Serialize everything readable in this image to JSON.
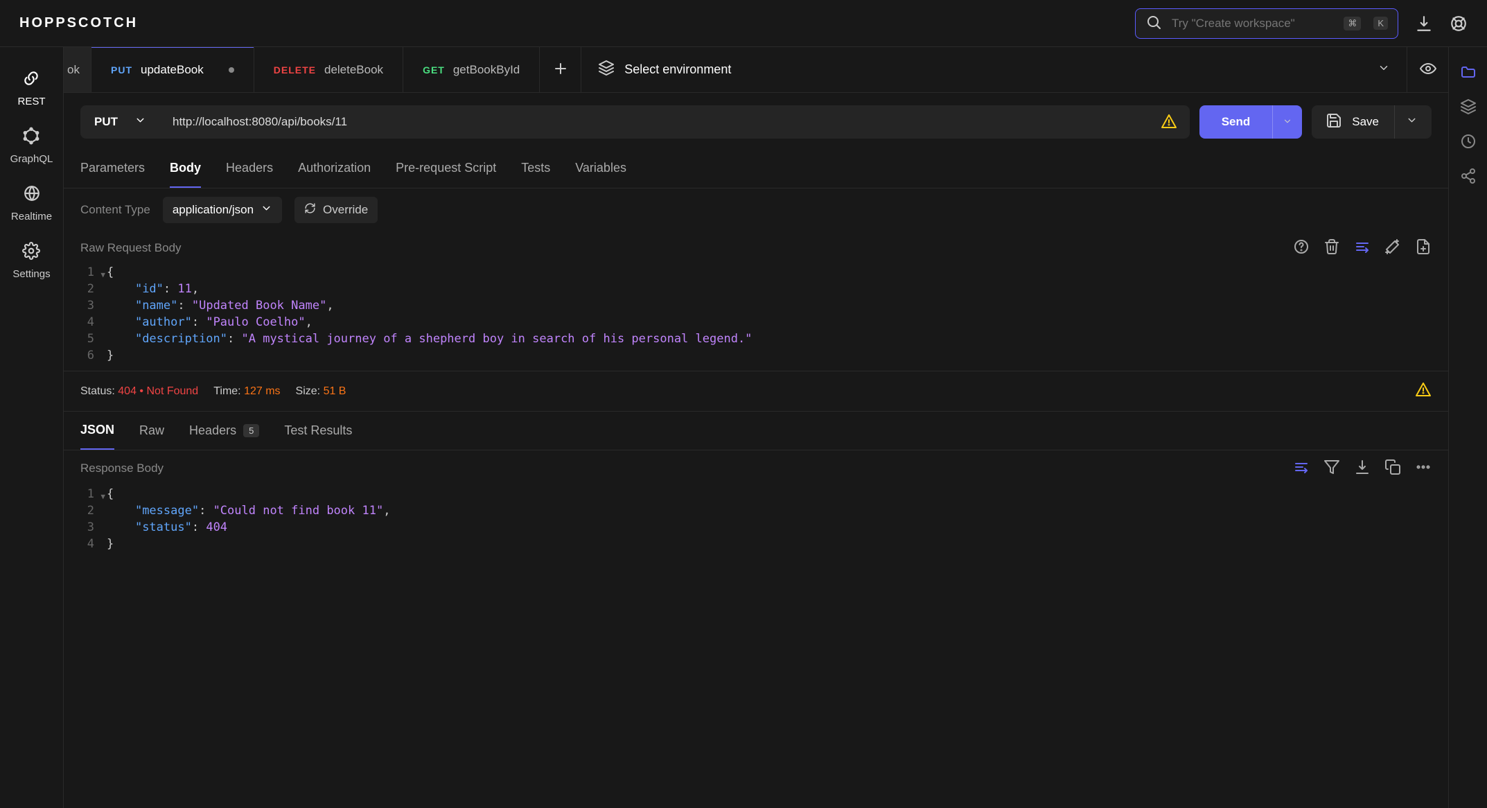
{
  "app": {
    "name": "HOPPSCOTCH"
  },
  "search": {
    "placeholder": "Try \"Create workspace\"",
    "shortcut_mod": "⌘",
    "shortcut_key": "K"
  },
  "leftnav": {
    "items": [
      {
        "label": "REST"
      },
      {
        "label": "GraphQL"
      },
      {
        "label": "Realtime"
      },
      {
        "label": "Settings"
      }
    ]
  },
  "tabs": {
    "partial": "ok",
    "items": [
      {
        "method": "PUT",
        "name": "updateBook",
        "dirty": true,
        "active": true
      },
      {
        "method": "DELETE",
        "name": "deleteBook"
      },
      {
        "method": "GET",
        "name": "getBookById"
      }
    ]
  },
  "environment": {
    "label": "Select environment"
  },
  "request": {
    "method": "PUT",
    "url": "http://localhost:8080/api/books/11",
    "send_label": "Send",
    "save_label": "Save"
  },
  "subtabs": [
    "Parameters",
    "Body",
    "Headers",
    "Authorization",
    "Pre-request Script",
    "Tests",
    "Variables"
  ],
  "subtab_active": "Body",
  "content_type": {
    "label": "Content Type",
    "value": "application/json",
    "override": "Override"
  },
  "body_section_label": "Raw Request Body",
  "request_body": {
    "lines": [
      {
        "n": 1,
        "fold": true,
        "segs": [
          {
            "t": "punc",
            "v": "{"
          }
        ]
      },
      {
        "n": 2,
        "segs": [
          {
            "t": "indent",
            "v": "    "
          },
          {
            "t": "key",
            "v": "\"id\""
          },
          {
            "t": "punc",
            "v": ": "
          },
          {
            "t": "num",
            "v": "11"
          },
          {
            "t": "punc",
            "v": ","
          }
        ]
      },
      {
        "n": 3,
        "segs": [
          {
            "t": "indent",
            "v": "    "
          },
          {
            "t": "key",
            "v": "\"name\""
          },
          {
            "t": "punc",
            "v": ": "
          },
          {
            "t": "str",
            "v": "\"Updated Book Name\""
          },
          {
            "t": "punc",
            "v": ","
          }
        ]
      },
      {
        "n": 4,
        "segs": [
          {
            "t": "indent",
            "v": "    "
          },
          {
            "t": "key",
            "v": "\"author\""
          },
          {
            "t": "punc",
            "v": ": "
          },
          {
            "t": "str",
            "v": "\"Paulo Coelho\""
          },
          {
            "t": "punc",
            "v": ","
          }
        ]
      },
      {
        "n": 5,
        "segs": [
          {
            "t": "indent",
            "v": "    "
          },
          {
            "t": "key",
            "v": "\"description\""
          },
          {
            "t": "punc",
            "v": ": "
          },
          {
            "t": "str",
            "v": "\"A mystical journey of a shepherd boy in search of his personal legend.\""
          }
        ]
      },
      {
        "n": 6,
        "segs": [
          {
            "t": "punc",
            "v": "}"
          }
        ]
      }
    ]
  },
  "response_status": {
    "status_label": "Status:",
    "status_code": "404",
    "status_text": "Not Found",
    "time_label": "Time:",
    "time_value": "127 ms",
    "size_label": "Size:",
    "size_value": "51 B"
  },
  "response_tabs": {
    "items": [
      "JSON",
      "Raw",
      "Headers",
      "Test Results"
    ],
    "active": "JSON",
    "headers_badge": "5"
  },
  "response_body_label": "Response Body",
  "response_body": {
    "lines": [
      {
        "n": 1,
        "fold": true,
        "segs": [
          {
            "t": "punc",
            "v": "{"
          }
        ]
      },
      {
        "n": 2,
        "segs": [
          {
            "t": "indent",
            "v": "    "
          },
          {
            "t": "key",
            "v": "\"message\""
          },
          {
            "t": "punc",
            "v": ": "
          },
          {
            "t": "str",
            "v": "\"Could not find book 11\""
          },
          {
            "t": "punc",
            "v": ","
          }
        ]
      },
      {
        "n": 3,
        "segs": [
          {
            "t": "indent",
            "v": "    "
          },
          {
            "t": "key",
            "v": "\"status\""
          },
          {
            "t": "punc",
            "v": ": "
          },
          {
            "t": "num",
            "v": "404"
          }
        ]
      },
      {
        "n": 4,
        "segs": [
          {
            "t": "punc",
            "v": "}"
          }
        ]
      }
    ]
  }
}
